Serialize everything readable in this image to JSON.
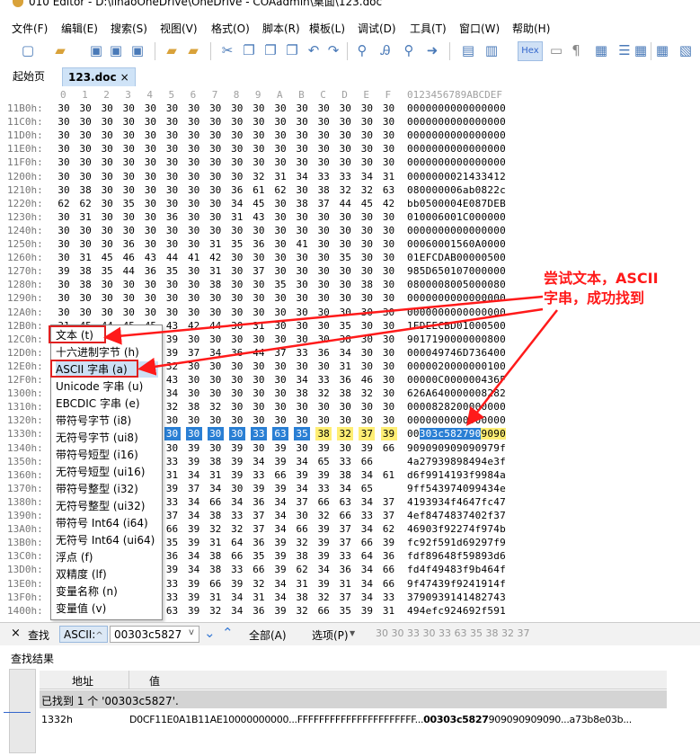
{
  "window": {
    "title": "010 Editor - D:\\lihaoOneDrive\\OneDrive - COAadmin\\桌面\\123.doc"
  },
  "menu": [
    "文件(F)",
    "编辑(E)",
    "搜索(S)",
    "视图(V)",
    "格式(O)",
    "脚本(R)",
    "模板(L)",
    "调试(D)",
    "工具(T)",
    "窗口(W)",
    "帮助(H)"
  ],
  "toolbar": {
    "hex_label": "Hex"
  },
  "tabs": [
    {
      "label": "起始页"
    },
    {
      "label": "123.doc",
      "close": "×"
    }
  ],
  "hex": {
    "columns": [
      "0",
      "1",
      "2",
      "3",
      "4",
      "5",
      "6",
      "7",
      "8",
      "9",
      "A",
      "B",
      "C",
      "D",
      "E",
      "F"
    ],
    "ascii_header": "0123456789ABCDEF",
    "rows": [
      {
        "addr": "11B0h:",
        "bytes": [
          "30",
          "30",
          "30",
          "30",
          "30",
          "30",
          "30",
          "30",
          "30",
          "30",
          "30",
          "30",
          "30",
          "30",
          "30",
          "30"
        ],
        "ascii": "0000000000000000"
      },
      {
        "addr": "11C0h:",
        "bytes": [
          "30",
          "30",
          "30",
          "30",
          "30",
          "30",
          "30",
          "30",
          "30",
          "30",
          "30",
          "30",
          "30",
          "30",
          "30",
          "30"
        ],
        "ascii": "0000000000000000"
      },
      {
        "addr": "11D0h:",
        "bytes": [
          "30",
          "30",
          "30",
          "30",
          "30",
          "30",
          "30",
          "30",
          "30",
          "30",
          "30",
          "30",
          "30",
          "30",
          "30",
          "30"
        ],
        "ascii": "0000000000000000"
      },
      {
        "addr": "11E0h:",
        "bytes": [
          "30",
          "30",
          "30",
          "30",
          "30",
          "30",
          "30",
          "30",
          "30",
          "30",
          "30",
          "30",
          "30",
          "30",
          "30",
          "30"
        ],
        "ascii": "0000000000000000"
      },
      {
        "addr": "11F0h:",
        "bytes": [
          "30",
          "30",
          "30",
          "30",
          "30",
          "30",
          "30",
          "30",
          "30",
          "30",
          "30",
          "30",
          "30",
          "30",
          "30",
          "30"
        ],
        "ascii": "0000000000000000"
      },
      {
        "addr": "1200h:",
        "bytes": [
          "30",
          "30",
          "30",
          "30",
          "30",
          "30",
          "30",
          "30",
          "30",
          "32",
          "31",
          "34",
          "33",
          "33",
          "34",
          "31",
          "32"
        ],
        "ascii": "0000000021433412"
      },
      {
        "addr": "1210h:",
        "bytes": [
          "30",
          "38",
          "30",
          "30",
          "30",
          "30",
          "30",
          "30",
          "36",
          "61",
          "62",
          "30",
          "38",
          "32",
          "32",
          "63"
        ],
        "ascii": "080000006ab0822c"
      },
      {
        "addr": "1220h:",
        "bytes": [
          "62",
          "62",
          "30",
          "35",
          "30",
          "30",
          "30",
          "30",
          "34",
          "45",
          "30",
          "38",
          "37",
          "44",
          "45",
          "42"
        ],
        "ascii": "bb0500004E087DEB"
      },
      {
        "addr": "1230h:",
        "bytes": [
          "30",
          "31",
          "30",
          "30",
          "30",
          "36",
          "30",
          "30",
          "31",
          "43",
          "30",
          "30",
          "30",
          "30",
          "30",
          "30"
        ],
        "ascii": "010006001C000000"
      },
      {
        "addr": "1240h:",
        "bytes": [
          "30",
          "30",
          "30",
          "30",
          "30",
          "30",
          "30",
          "30",
          "30",
          "30",
          "30",
          "30",
          "30",
          "30",
          "30",
          "30"
        ],
        "ascii": "0000000000000000"
      },
      {
        "addr": "1250h:",
        "bytes": [
          "30",
          "30",
          "30",
          "36",
          "30",
          "30",
          "30",
          "31",
          "35",
          "36",
          "30",
          "41",
          "30",
          "30",
          "30",
          "30"
        ],
        "ascii": "00060001560A0000"
      },
      {
        "addr": "1260h:",
        "bytes": [
          "30",
          "31",
          "45",
          "46",
          "43",
          "44",
          "41",
          "42",
          "30",
          "30",
          "30",
          "30",
          "30",
          "35",
          "30",
          "30"
        ],
        "ascii": "01EFCDAB00000500"
      },
      {
        "addr": "1270h:",
        "bytes": [
          "39",
          "38",
          "35",
          "44",
          "36",
          "35",
          "30",
          "31",
          "30",
          "37",
          "30",
          "30",
          "30",
          "30",
          "30",
          "30"
        ],
        "ascii": "985D650107000000"
      },
      {
        "addr": "1280h:",
        "bytes": [
          "30",
          "38",
          "30",
          "30",
          "30",
          "30",
          "30",
          "38",
          "30",
          "30",
          "35",
          "30",
          "30",
          "30",
          "38",
          "30"
        ],
        "ascii": "0800008005000080"
      },
      {
        "addr": "1290h:",
        "bytes": [
          "30",
          "30",
          "30",
          "30",
          "30",
          "30",
          "30",
          "30",
          "30",
          "30",
          "30",
          "30",
          "30",
          "30",
          "30",
          "30"
        ],
        "ascii": "0000000000000000"
      },
      {
        "addr": "12A0h:",
        "bytes": [
          "30",
          "30",
          "30",
          "30",
          "30",
          "30",
          "30",
          "30",
          "30",
          "30",
          "30",
          "30",
          "30",
          "30",
          "30",
          "30"
        ],
        "ascii": "0000000000000000"
      },
      {
        "addr": "12B0h:",
        "bytes": [
          "31",
          "45",
          "44",
          "45",
          "45",
          "43",
          "42",
          "44",
          "30",
          "31",
          "30",
          "30",
          "30",
          "35",
          "30",
          "30"
        ],
        "ascii": "1EDEECBD01000500"
      },
      {
        "addr": "12C0h:",
        "bytes": [
          "39",
          "30",
          "31",
          "37",
          "31",
          "39",
          "30",
          "30",
          "30",
          "30",
          "30",
          "30",
          "30",
          "38",
          "30",
          "30"
        ],
        "ascii": "9017190000000800"
      },
      {
        "addr": "12D0h:",
        "bytes": [
          "30",
          "30",
          "30",
          "30",
          "34",
          "39",
          "37",
          "34",
          "36",
          "44",
          "37",
          "33",
          "36",
          "34",
          "30",
          "30"
        ],
        "ascii": "000049746D736400"
      },
      {
        "addr": "12E0h:",
        "bytes": [
          "30",
          "30",
          "30",
          "30",
          "30",
          "32",
          "30",
          "30",
          "30",
          "30",
          "30",
          "30",
          "30",
          "31",
          "30",
          "30"
        ],
        "ascii": "0000020000000100"
      },
      {
        "addr": "12F0h:",
        "bytes": [
          "30",
          "30",
          "30",
          "30",
          "30",
          "43",
          "30",
          "30",
          "30",
          "30",
          "30",
          "34",
          "33",
          "36",
          "46",
          "30"
        ],
        "ascii": "00000C000000436F"
      },
      {
        "addr": "1300h:",
        "bytes": [
          "36",
          "32",
          "36",
          "41",
          "36",
          "34",
          "30",
          "30",
          "30",
          "30",
          "30",
          "38",
          "32",
          "38",
          "32",
          "30"
        ],
        "ascii": "626A640000008282"
      },
      {
        "addr": "1310h:",
        "bytes": [
          "30",
          "30",
          "30",
          "30",
          "38",
          "32",
          "38",
          "32",
          "30",
          "30",
          "30",
          "30",
          "30",
          "30",
          "30",
          "30"
        ],
        "ascii": "0000828200000000"
      },
      {
        "addr": "1320h:",
        "bytes": [
          "30",
          "30",
          "30",
          "30",
          "30",
          "30",
          "30",
          "30",
          "30",
          "30",
          "30",
          "30",
          "30",
          "30",
          "30",
          "30"
        ],
        "ascii": "0000000000000000"
      },
      {
        "addr": "1330h:",
        "bytes": [
          "30",
          "30",
          "30",
          "30",
          "30",
          "30",
          "30",
          "30",
          "30",
          "33",
          "63",
          "35",
          "38",
          "32",
          "37",
          "39",
          "30",
          "39",
          "30"
        ],
        "ascii": "00303c5827909090"
      },
      {
        "addr": "1340h:",
        "bytes": [
          "39",
          "30",
          "39",
          "30",
          "39",
          "30",
          "39",
          "30",
          "39",
          "30",
          "39",
          "30",
          "39",
          "30",
          "39",
          "66"
        ],
        "ascii": "909090909090979f"
      },
      {
        "addr": "1350h:",
        "bytes": [
          "34",
          "61",
          "32",
          "37",
          "39",
          "33",
          "39",
          "38",
          "39",
          "34",
          "39",
          "34",
          "65",
          "33",
          "66"
        ],
        "ascii": "4a27939898494e3f"
      },
      {
        "addr": "1360h:",
        "bytes": [
          "64",
          "36",
          "66",
          "39",
          "39",
          "31",
          "34",
          "31",
          "39",
          "33",
          "66",
          "39",
          "39",
          "38",
          "34",
          "61"
        ],
        "ascii": "d6f9914193f9984a"
      },
      {
        "addr": "1370h:",
        "bytes": [
          "39",
          "66",
          "35",
          "34",
          "33",
          "39",
          "37",
          "34",
          "30",
          "39",
          "39",
          "34",
          "33",
          "34",
          "65"
        ],
        "ascii": "9ff543974099434e"
      },
      {
        "addr": "1380h:",
        "bytes": [
          "34",
          "31",
          "39",
          "33",
          "39",
          "33",
          "34",
          "66",
          "34",
          "36",
          "34",
          "37",
          "66",
          "63",
          "34",
          "37"
        ],
        "ascii": "4193934f4647fc47"
      },
      {
        "addr": "1390h:",
        "bytes": [
          "34",
          "65",
          "66",
          "38",
          "34",
          "37",
          "34",
          "38",
          "33",
          "37",
          "34",
          "30",
          "32",
          "66",
          "33",
          "37"
        ],
        "ascii": "4ef8474837402f37"
      },
      {
        "addr": "13A0h:",
        "bytes": [
          "34",
          "36",
          "39",
          "30",
          "33",
          "66",
          "39",
          "32",
          "32",
          "37",
          "34",
          "66",
          "39",
          "37",
          "34",
          "62"
        ],
        "ascii": "46903f92274f974b"
      },
      {
        "addr": "13B0h:",
        "bytes": [
          "66",
          "63",
          "39",
          "32",
          "66",
          "35",
          "39",
          "31",
          "64",
          "36",
          "39",
          "32",
          "39",
          "37",
          "66",
          "39"
        ],
        "ascii": "fc92f591d69297f9"
      },
      {
        "addr": "13C0h:",
        "bytes": [
          "66",
          "64",
          "66",
          "38",
          "39",
          "36",
          "34",
          "38",
          "66",
          "35",
          "39",
          "38",
          "39",
          "33",
          "64",
          "36"
        ],
        "ascii": "fdf89648f59893d6"
      },
      {
        "addr": "13D0h:",
        "bytes": [
          "66",
          "64",
          "34",
          "66",
          "34",
          "39",
          "34",
          "38",
          "33",
          "66",
          "39",
          "62",
          "34",
          "36",
          "34",
          "66"
        ],
        "ascii": "fd4f49483f9b464f"
      },
      {
        "addr": "13E0h:",
        "bytes": [
          "39",
          "66",
          "34",
          "37",
          "34",
          "33",
          "39",
          "66",
          "39",
          "32",
          "34",
          "31",
          "39",
          "31",
          "34",
          "66"
        ],
        "ascii": "9f47439f9241914f"
      },
      {
        "addr": "13F0h:",
        "bytes": [
          "33",
          "37",
          "39",
          "30",
          "39",
          "33",
          "39",
          "31",
          "34",
          "31",
          "34",
          "38",
          "32",
          "37",
          "34",
          "33"
        ],
        "ascii": "3790939141482743"
      },
      {
        "addr": "1400h:",
        "bytes": [
          "34",
          "39",
          "34",
          "65",
          "66",
          "63",
          "39",
          "32",
          "34",
          "36",
          "39",
          "32",
          "66",
          "35",
          "39",
          "31"
        ],
        "ascii": "494efc924692f591"
      },
      {
        "addr": "1410h:",
        "bytes": [
          "",
          "",
          "",
          "",
          "",
          "",
          "",
          "",
          "",
          "",
          "",
          "",
          "",
          "",
          "",
          ""
        ],
        "ascii": ""
      }
    ]
  },
  "popup": {
    "items": [
      "文本 (t)",
      "十六进制字节 (h)",
      "ASCII 字串 (a)",
      "Unicode 字串 (u)",
      "EBCDIC 字串 (e)",
      "带符号字节 (i8)",
      "无符号字节 (ui8)",
      "带符号短型 (i16)",
      "无符号短型 (ui16)",
      "带符号整型 (i32)",
      "无符号整型 (ui32)",
      "带符号 Int64 (i64)",
      "无符号 Int64 (ui64)",
      "浮点 (f)",
      "双精度 (lf)",
      "变量名称 (n)",
      "变量值 (v)"
    ]
  },
  "find": {
    "close": "×",
    "label": "查找",
    "type": "ASCII:",
    "query": "00303c5827",
    "all_label": "全部(A)",
    "options_label": "选项(P)",
    "hex_preview": "30 30 33 30 33 63 35 38 32 37"
  },
  "results": {
    "title": "查找结果",
    "col_address": "地址",
    "col_value": "值",
    "summary": "已找到 1 个 '00303c5827'.",
    "row_addr": "1332h",
    "row_value_a": "D0CF11E0A1B11AE10000000000...FFFFFFFFFFFFFFFFFFFFFF...",
    "row_value_match": "00303c5827",
    "row_value_b": "909090909090...a73b8e03b..."
  },
  "annotation": {
    "line1": "尝试文本，ASCII",
    "line2": "字串，成功找到"
  },
  "colors": {
    "accent": "#2a7fd4",
    "highlight": "#ffee74",
    "annotation": "#ff1a1a"
  }
}
